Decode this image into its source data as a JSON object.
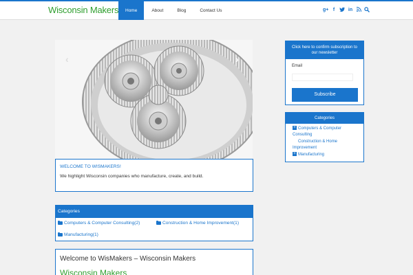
{
  "colors": {
    "accent": "#1a75cc",
    "brand_green": "#2e9e2e",
    "background": "#f1f1f1"
  },
  "header": {
    "logo_part1": "Wisconsin",
    "logo_part2": " Makers",
    "nav": [
      {
        "label": "Home",
        "active": true
      },
      {
        "label": "About"
      },
      {
        "label": "Blog"
      },
      {
        "label": "Contact Us"
      }
    ],
    "social_icons": [
      "google-plus-icon",
      "facebook-icon",
      "twitter-icon",
      "linkedin-icon",
      "rss-icon",
      "search-icon"
    ]
  },
  "slider": {
    "image": "planetary-gears-image",
    "prev_icon": "chevron-left-icon",
    "next_icon": "chevron-right-icon"
  },
  "welcome": {
    "title": "WELCOME TO WISMAKERS!",
    "text": "We highlight Wisconsin companies who manufacture, create, and build."
  },
  "categories_main": {
    "title": "Categories",
    "items": [
      {
        "label": "Computers & Computer Consulting(2)"
      },
      {
        "label": "Construction & Home Improvement(1)"
      },
      {
        "label": "Manufacturing(1)"
      }
    ]
  },
  "post": {
    "title": "Welcome to WisMakers – Wisconsin Makers",
    "subtitle": "Wisconsin Makers"
  },
  "newsletter": {
    "header_line1": "Click here to confirm subscription to",
    "header_line2": "our newsletter",
    "email_label": "Email",
    "email_value": "",
    "button_label": "Subscribe"
  },
  "categories_side": {
    "title": "Categories",
    "items": [
      {
        "label_line1": "Computers & Computer",
        "label_line2": "Consulting",
        "expandable": true
      },
      {
        "label_line1": "Construction & Home",
        "label_line2": "Improvement",
        "expandable": false
      },
      {
        "label_line1": "Manufacturing",
        "label_line2": "",
        "expandable": true
      }
    ]
  }
}
